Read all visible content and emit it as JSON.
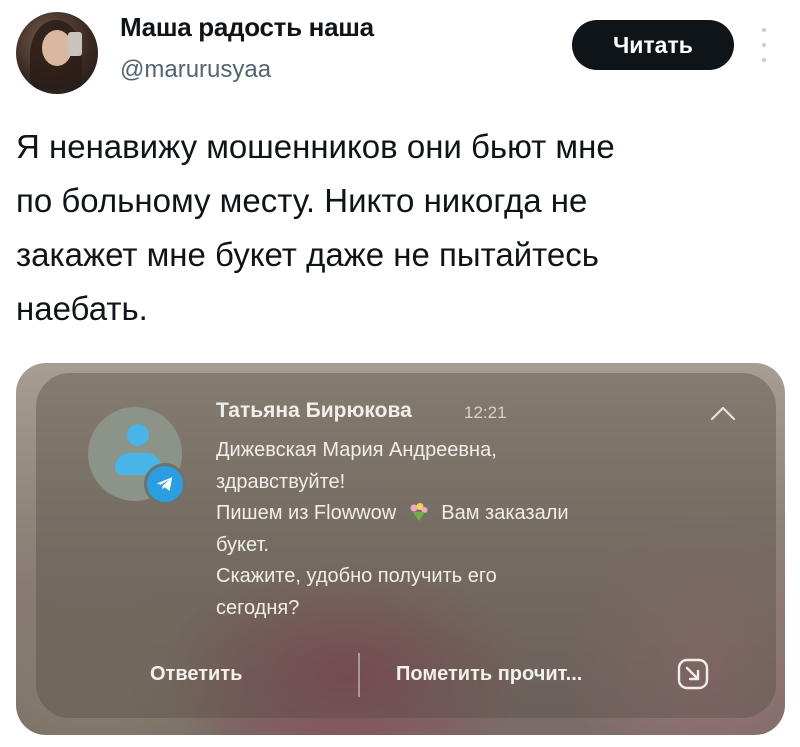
{
  "author": {
    "display_name": "Маша радость наша",
    "handle": "@maruruѕyaa"
  },
  "header": {
    "read_button_label": "Читать"
  },
  "tweet": {
    "lines": [
      "Я ненавижу мошенников они бьют мне",
      "по больному месту. Никто никогда не",
      "закажет мне букет даже не пытайтесь",
      "наебать."
    ]
  },
  "notification": {
    "sender": "Татьяна Бирюкова",
    "time": "12:21",
    "message_lines": [
      "Дижевская Мария Андреевна,",
      "здравствуйте!",
      "Пишем из Flowwow",
      "Вам заказали",
      "букет.",
      "Скажите, удобно получить его",
      "сегодня?"
    ],
    "actions": {
      "reply": "Ответить",
      "mark_read": "Пометить прочит..."
    }
  },
  "icons": {
    "more": "more-vertical-icon",
    "app_badge": "telegram-icon",
    "collapse": "chevron-up-icon",
    "expand": "expand-icon",
    "bouquet": "bouquet-emoji-icon"
  },
  "colors": {
    "button_bg": "#0f1419",
    "handle": "#536471",
    "telegram": "#2a9ee0"
  }
}
